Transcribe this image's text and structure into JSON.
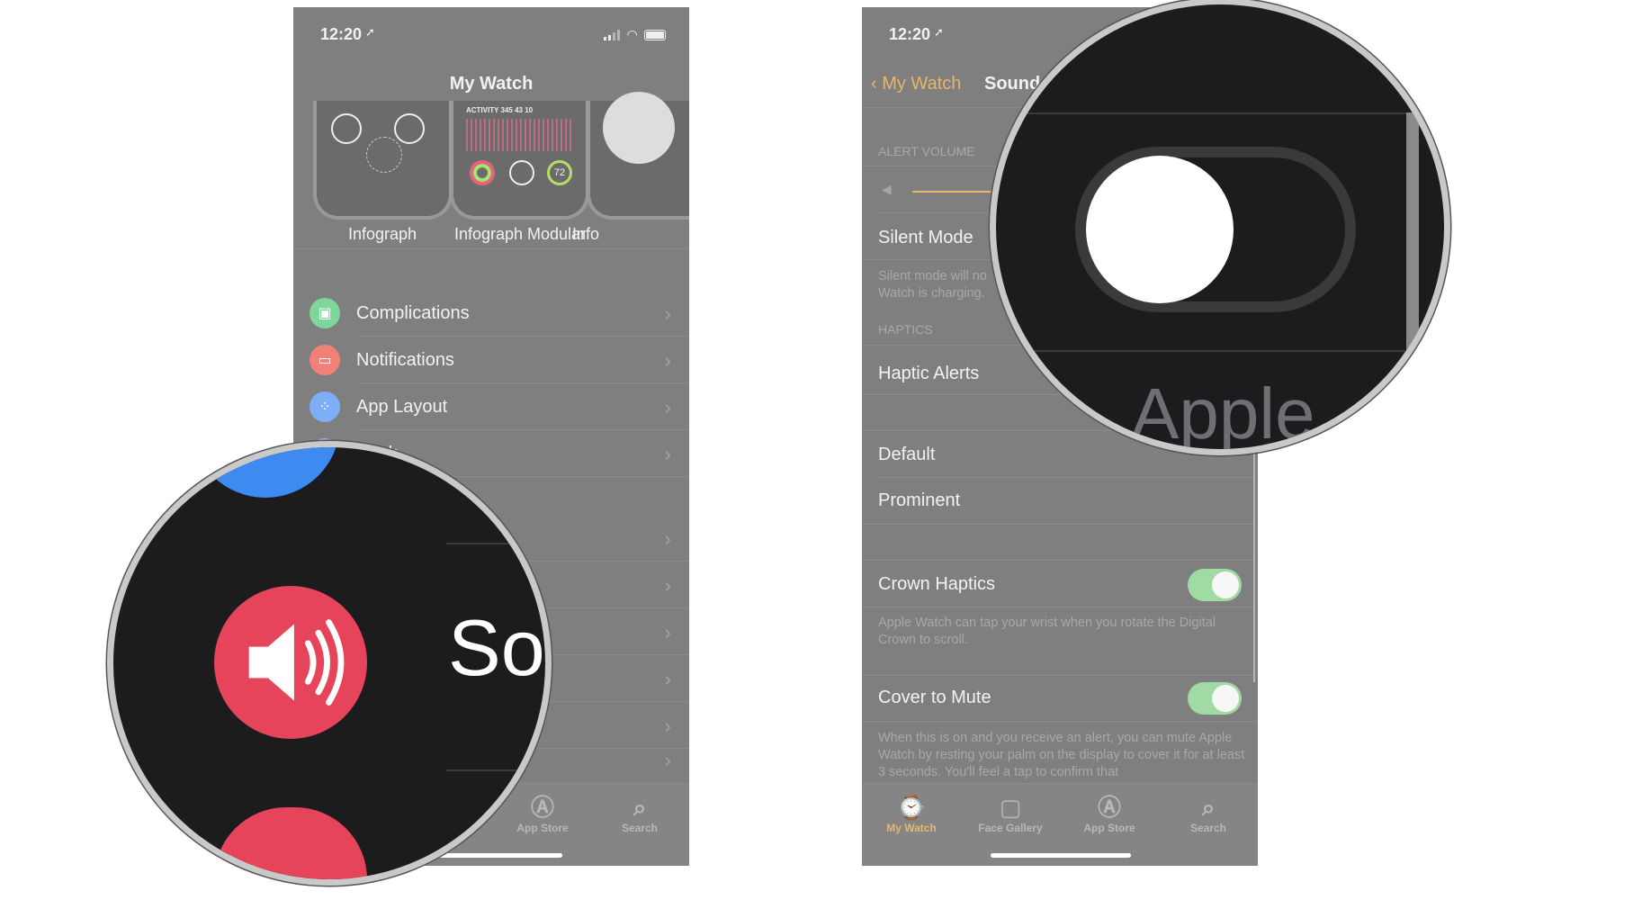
{
  "status": {
    "time": "12:20"
  },
  "left_phone": {
    "title": "My Watch",
    "faces": [
      {
        "label": "Infograph",
        "complication": "ACTIVITY 345 43 10"
      },
      {
        "label": "Infograph Modular"
      },
      {
        "label": "Info"
      }
    ],
    "menu": [
      {
        "label": "Complications",
        "icon": "complications-icon",
        "color": "#7ed69a"
      },
      {
        "label": "Notifications",
        "icon": "notifications-icon",
        "color": "#f08179"
      },
      {
        "label": "App Layout",
        "icon": "app-layout-icon",
        "color": "#7eaef5"
      },
      {
        "label": "Dock",
        "icon": "dock-icon",
        "color": "#c9a0ea"
      }
    ],
    "tabs": [
      {
        "label": "App Store"
      },
      {
        "label": "Search"
      }
    ]
  },
  "right_phone": {
    "back": "My Watch",
    "title": "Sounds",
    "alert_volume_header": "ALERT VOLUME",
    "volume_level": 0.35,
    "silent_mode": "Silent Mode",
    "silent_desc": "Silent mode will no",
    "silent_desc2": "Watch is charging.",
    "haptics_header": "HAPTICS",
    "haptic_alerts": "Haptic Alerts",
    "default": "Default",
    "prominent": "Prominent",
    "crown_haptics": "Crown Haptics",
    "crown_haptics_on": true,
    "crown_desc": "Apple Watch can tap your wrist when you rotate the Digital Crown to scroll.",
    "cover_to_mute": "Cover to Mute",
    "cover_to_mute_on": true,
    "cover_desc": "When this is on and you receive an alert, you can mute Apple Watch by resting your palm on the display to cover it for at least 3 seconds. You'll feel a tap to confirm that",
    "tabs": [
      {
        "label": "My Watch"
      },
      {
        "label": "Face Gallery"
      },
      {
        "label": "App Store"
      },
      {
        "label": "Search"
      }
    ],
    "accent": "#e6b66e"
  },
  "zoom_left": {
    "text": "So",
    "icon": "sounds-icon",
    "color": "#e5445a"
  },
  "zoom_right": {
    "text": "Apple",
    "toggle_on": false
  }
}
